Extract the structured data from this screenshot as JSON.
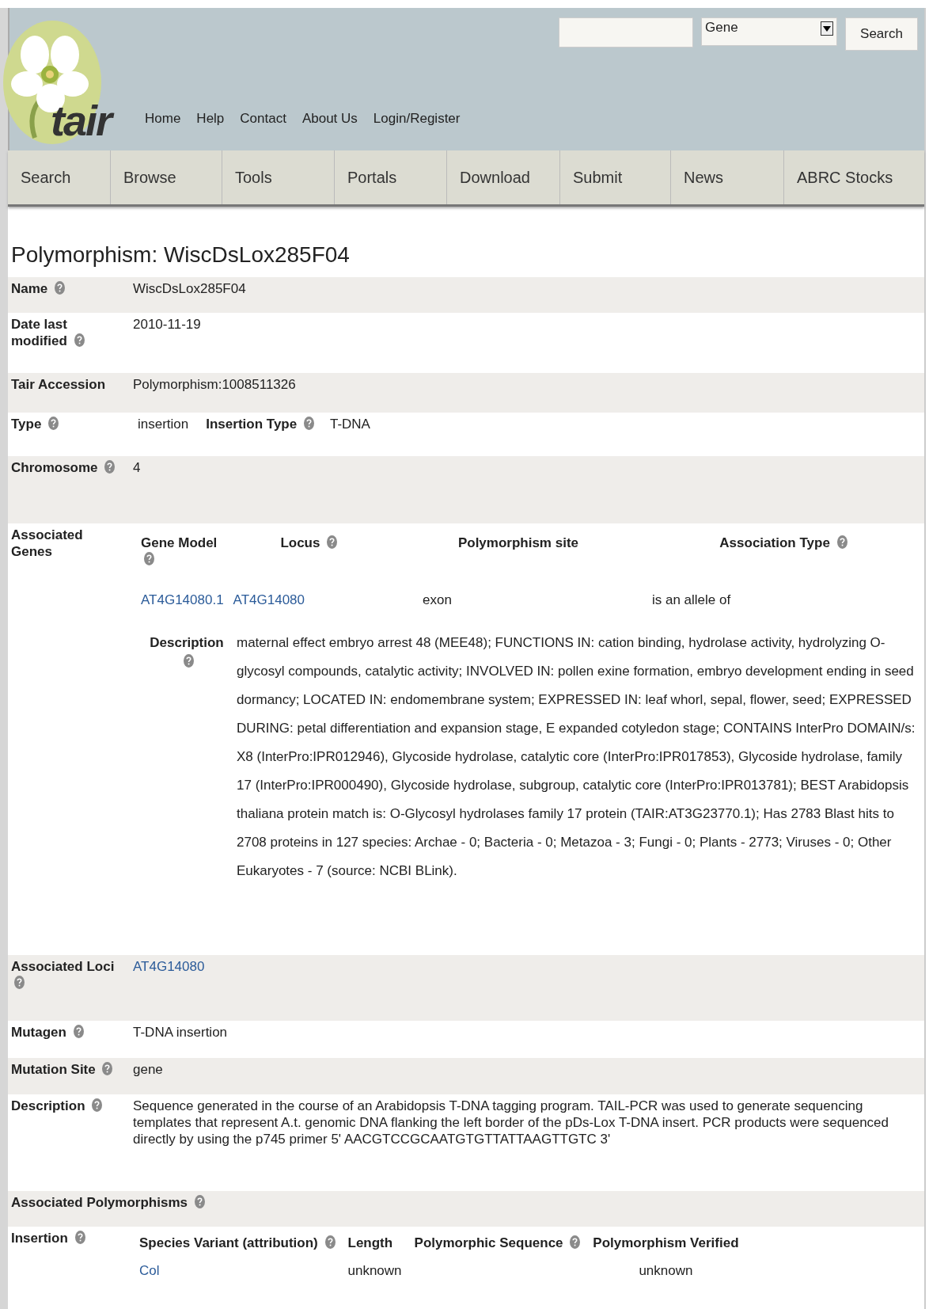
{
  "header": {
    "logo_text": "tair",
    "search_select": "Gene",
    "search_button": "Search"
  },
  "top_links": [
    "Home",
    "Help",
    "Contact",
    "About Us",
    "Login/Register"
  ],
  "nav_tabs": [
    "Search",
    "Browse",
    "Tools",
    "Portals",
    "Download",
    "Submit",
    "News",
    "ABRC Stocks"
  ],
  "title": "Polymorphism: WiscDsLox285F04",
  "rows": [
    {
      "kind": "text",
      "label": "Name",
      "help": true,
      "value": "WiscDsLox285F04"
    },
    {
      "kind": "text",
      "label": "Date last modified",
      "help": true,
      "value": "2010-11-19"
    },
    {
      "kind": "text",
      "label": "Tair Accession",
      "help": false,
      "value": "Polymorphism:1008511326"
    },
    {
      "kind": "pair",
      "label": "Type",
      "help": true,
      "value": "insertion",
      "sub_label": "Insertion Type",
      "sub_help": true,
      "sub_value": "T-DNA"
    },
    {
      "kind": "text",
      "label": "Chromosome",
      "help": true,
      "value": "4"
    },
    {
      "kind": "genes",
      "label": "Associated Genes",
      "help": false,
      "columns": [
        {
          "label": "Gene Model",
          "help": true
        },
        {
          "label": "Locus",
          "help": true
        },
        {
          "label": "Polymorphism site",
          "help": false
        },
        {
          "label": "Association Type",
          "help": true
        }
      ],
      "genes": [
        {
          "gene_model": "AT4G14080.1",
          "locus": "AT4G14080",
          "site": "exon",
          "association_type": "is an allele of"
        }
      ],
      "description": {
        "label": "Description",
        "help": true,
        "text": "maternal effect embryo arrest 48 (MEE48); FUNCTIONS IN: cation binding, hydrolase activity, hydrolyzing O-glycosyl compounds, catalytic activity; INVOLVED IN: pollen exine formation, embryo development ending in seed dormancy; LOCATED IN: endomembrane system; EXPRESSED IN: leaf whorl, sepal, flower, seed; EXPRESSED DURING: petal differentiation and expansion stage, E expanded cotyledon stage; CONTAINS InterPro DOMAIN/s: X8 (InterPro:IPR012946), Glycoside hydrolase, catalytic core (InterPro:IPR017853), Glycoside hydrolase, family 17 (InterPro:IPR000490), Glycoside hydrolase, subgroup, catalytic core (InterPro:IPR013781); BEST Arabidopsis thaliana protein match is: O-Glycosyl hydrolases family 17 protein (TAIR:AT3G23770.1); Has 2783 Blast hits to 2708 proteins in 127 species: Archae - 0; Bacteria - 0; Metazoa - 3; Fungi - 0; Plants - 2773; Viruses - 0; Other Eukaryotes - 7 (source: NCBI BLink)."
      }
    },
    {
      "kind": "link",
      "label": "Associated Loci",
      "help": true,
      "value": "AT4G14080"
    },
    {
      "kind": "text",
      "label": "Mutagen",
      "help": true,
      "value": "T-DNA insertion"
    },
    {
      "kind": "text",
      "label": "Mutation Site",
      "help": true,
      "value": "gene"
    },
    {
      "kind": "text",
      "label": "Description",
      "help": true,
      "value": "Sequence generated in the course of an Arabidopsis T-DNA tagging program. TAIL-PCR was used to generate sequencing templates that represent A.t. genomic DNA flanking the left border of the pDs-Lox T-DNA insert. PCR products were sequenced directly by using the p745 primer 5' AACGTCCGCAATGTGTTATTAAGTTGTC 3'"
    },
    {
      "kind": "heading",
      "label": "Associated Polymorphisms",
      "help": true
    },
    {
      "kind": "variants",
      "label": "Insertion",
      "help": true,
      "columns": [
        {
          "label": "Species Variant (attribution)",
          "help": true
        },
        {
          "label": "Length",
          "help": false
        },
        {
          "label": "Polymorphic Sequence",
          "help": true
        },
        {
          "label": "Polymorphism Verified",
          "help": false
        }
      ],
      "variants": [
        {
          "species_variant": "Col",
          "length": "unknown",
          "polymorphism_verified": "unknown"
        }
      ]
    }
  ]
}
